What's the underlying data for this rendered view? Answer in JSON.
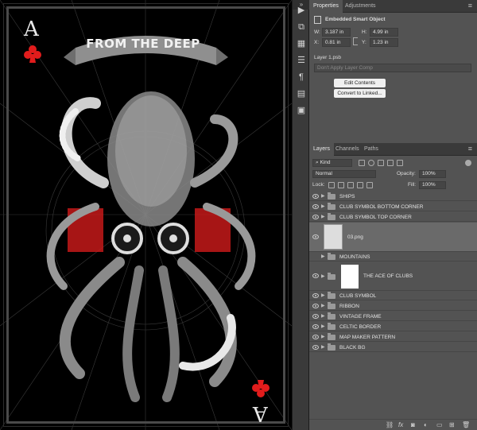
{
  "canvas": {
    "rank": "A",
    "ribbon_text": "FROM THE DEEP",
    "club_color": "#e11c1c"
  },
  "tool_strip": {
    "icons": [
      "play-icon",
      "layer-comps-icon",
      "properties-icon",
      "adjustments-icon",
      "paragraph-icon",
      "info-icon",
      "notes-icon"
    ]
  },
  "properties_panel": {
    "tabs": [
      "Properties",
      "Adjustments"
    ],
    "active_tab": "Properties",
    "header": "Embedded Smart Object",
    "w_label": "W:",
    "w_value": "3.187 in",
    "h_label": "H:",
    "h_value": "4.99 in",
    "x_label": "X:",
    "x_value": "0.81 in",
    "y_label": "Y:",
    "y_value": "1.23 in",
    "file_name": "Layer 1.psb",
    "layer_comp_placeholder": "Don't Apply Layer Comp",
    "edit_contents": "Edit Contents",
    "convert_to_linked": "Convert to Linked..."
  },
  "layers_panel": {
    "tabs": [
      "Layers",
      "Channels",
      "Paths"
    ],
    "active_tab": "Layers",
    "filter_kind": "Kind",
    "blend_mode": "Normal",
    "opacity_label": "Opacity:",
    "opacity_value": "100%",
    "lock_label": "Lock:",
    "fill_label": "Fill:",
    "fill_value": "100%",
    "layers": [
      {
        "name": "SHIPS",
        "type": "group"
      },
      {
        "name": "CLUB SYMBOL BOTTOM CORNER",
        "type": "group"
      },
      {
        "name": "CLUB SYMBOL TOP CORNER",
        "type": "group"
      },
      {
        "name": "03.png",
        "type": "image",
        "selected": true
      },
      {
        "name": "MOUNTAINS",
        "type": "group"
      },
      {
        "name": "THE ACE OF CLUBS",
        "type": "group"
      },
      {
        "name": "CLUB SYMBOL",
        "type": "group"
      },
      {
        "name": "RIBBON",
        "type": "group"
      },
      {
        "name": "VINTAGE FRAME",
        "type": "group"
      },
      {
        "name": "CELTIC BORDER",
        "type": "group"
      },
      {
        "name": "MAP MAKER PATTERN",
        "type": "group"
      },
      {
        "name": "BLACK BG",
        "type": "group"
      }
    ],
    "footer_icons": [
      "link-icon",
      "fx-icon",
      "mask-icon",
      "adjustment-icon",
      "folder-icon",
      "new-layer-icon",
      "trash-icon"
    ]
  }
}
